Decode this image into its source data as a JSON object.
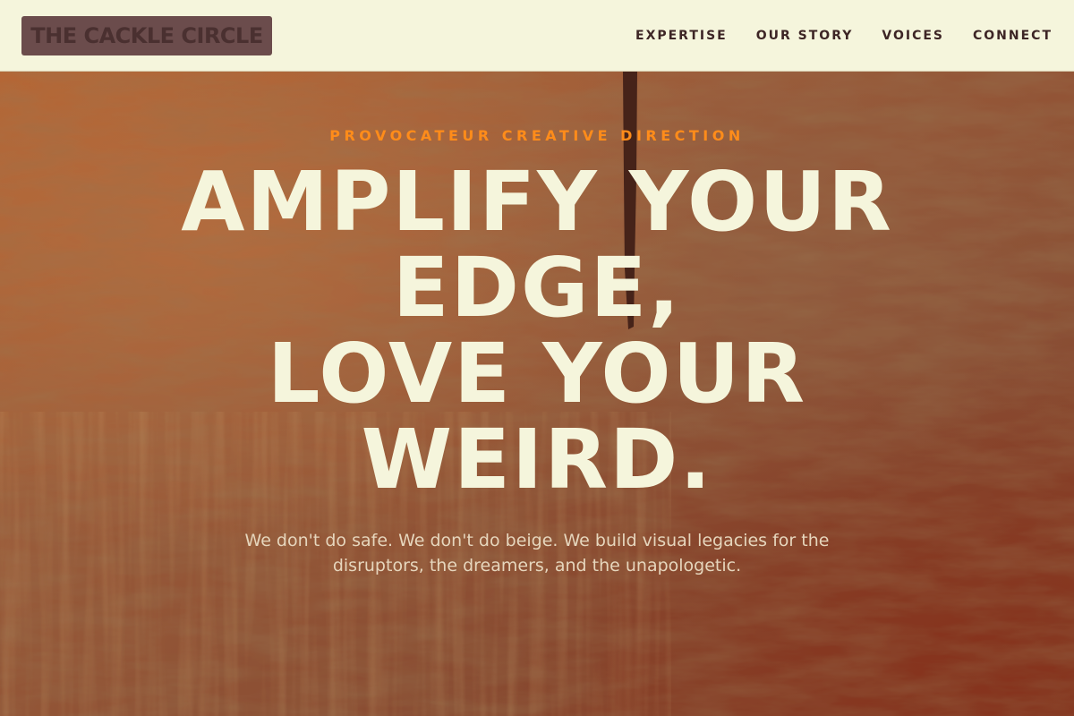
{
  "header": {
    "logo_text": "THE CACKLE CIRCLE",
    "nav": [
      {
        "label": "EXPERTISE"
      },
      {
        "label": "OUR STORY"
      },
      {
        "label": "VOICES"
      },
      {
        "label": "CONNECT"
      }
    ]
  },
  "hero": {
    "eyebrow": "PROVOCATEUR CREATIVE DIRECTION",
    "headline_lines": [
      "AMPLIFY YOUR",
      "EDGE,",
      "LOVE YOUR",
      "WEIRD."
    ],
    "subtext": "We don't do safe. We don't do beige. We build visual legacies for the disruptors, the dreamers, and the unapologetic."
  },
  "colors": {
    "nav_background": "#f5f5dc",
    "logo_background": "#6b4c4c",
    "accent": "#ff8c1a",
    "headline": "#f5f5dc",
    "hero_background": "#a0603a"
  }
}
